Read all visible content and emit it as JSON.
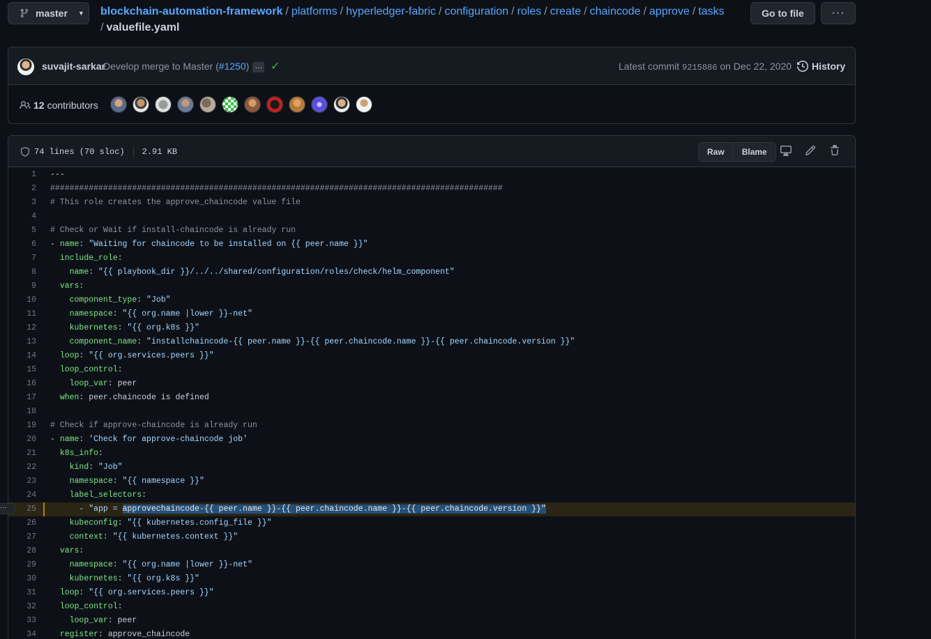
{
  "branch": {
    "label": "master",
    "icon": "git-branch-icon"
  },
  "breadcrumb": {
    "repo": "blockchain-automation-framework",
    "parts": [
      "platforms",
      "hyperledger-fabric",
      "configuration",
      "roles",
      "create",
      "chaincode",
      "approve",
      "tasks"
    ],
    "file": "valuefile.yaml",
    "separator": "/"
  },
  "actions": {
    "goto_file": "Go to file",
    "more": "···"
  },
  "commit": {
    "author": "suvajit-sarkar",
    "message": "Develop merge to Master (",
    "pr": "#1250",
    "message_end": ")",
    "ellipsis": "…",
    "status": "✓",
    "latest_prefix": "Latest commit",
    "sha": "9215886",
    "date": "on Dec 22, 2020",
    "history": "History"
  },
  "contributors": {
    "count": "12",
    "label": "contributors",
    "avatar_colors": [
      "#5a6b8a",
      "#3a3a3a",
      "#9a9a9a",
      "#6d7a95",
      "#7a6a5a",
      "#3fb950",
      "#8a5a3a",
      "#c81e1e",
      "#b07a3a",
      "#5b4fd8",
      "#2a2a2a",
      "#d0b090"
    ]
  },
  "file": {
    "lines": "74 lines (70 sloc)",
    "size": "2.91 KB",
    "raw": "Raw",
    "blame": "Blame"
  },
  "code": [
    {
      "n": "1",
      "t": "---"
    },
    {
      "n": "2",
      "t": "##############################################################################################"
    },
    {
      "n": "3",
      "t": "# This role creates the approve_chaincode value file"
    },
    {
      "n": "4",
      "t": ""
    },
    {
      "n": "5",
      "t": "# Check or Wait if install-chaincode is already run"
    },
    {
      "n": "6",
      "t": "- name: \"Waiting for chaincode to be installed on {{ peer.name }}\""
    },
    {
      "n": "7",
      "t": "  include_role:"
    },
    {
      "n": "8",
      "t": "    name: \"{{ playbook_dir }}/../../shared/configuration/roles/check/helm_component\""
    },
    {
      "n": "9",
      "t": "  vars:"
    },
    {
      "n": "10",
      "t": "    component_type: \"Job\""
    },
    {
      "n": "11",
      "t": "    namespace: \"{{ org.name |lower }}-net\""
    },
    {
      "n": "12",
      "t": "    kubernetes: \"{{ org.k8s }}\""
    },
    {
      "n": "13",
      "t": "    component_name: \"installchaincode-{{ peer.name }}-{{ peer.chaincode.name }}-{{ peer.chaincode.version }}\""
    },
    {
      "n": "14",
      "t": "  loop: \"{{ org.services.peers }}\""
    },
    {
      "n": "15",
      "t": "  loop_control:"
    },
    {
      "n": "16",
      "t": "    loop_var: peer"
    },
    {
      "n": "17",
      "t": "  when: peer.chaincode is defined"
    },
    {
      "n": "18",
      "t": ""
    },
    {
      "n": "19",
      "t": "# Check if approve-chaincode is already run"
    },
    {
      "n": "20",
      "t": "- name: 'Check for approve-chaincode job'"
    },
    {
      "n": "21",
      "t": "  k8s_info:"
    },
    {
      "n": "22",
      "t": "    kind: \"Job\""
    },
    {
      "n": "23",
      "t": "    namespace: \"{{ namespace }}\""
    },
    {
      "n": "24",
      "t": "    label_selectors:"
    },
    {
      "n": "25",
      "t": "      - \"app = approvechaincode-{{ peer.name }}-{{ peer.chaincode.name }}-{{ peer.chaincode.version }}\""
    },
    {
      "n": "26",
      "t": "    kubeconfig: \"{{ kubernetes.config_file }}\""
    },
    {
      "n": "27",
      "t": "    context: \"{{ kubernetes.context }}\""
    },
    {
      "n": "28",
      "t": "  vars:"
    },
    {
      "n": "29",
      "t": "    namespace: \"{{ org.name |lower }}-net\""
    },
    {
      "n": "30",
      "t": "    kubernetes: \"{{ org.k8s }}\""
    },
    {
      "n": "31",
      "t": "  loop: \"{{ org.services.peers }}\""
    },
    {
      "n": "32",
      "t": "  loop_control:"
    },
    {
      "n": "33",
      "t": "    loop_var: peer"
    },
    {
      "n": "34",
      "t": "  register: approve_chaincode"
    }
  ],
  "highlight": {
    "line": "25",
    "prefix": "      - \"app = ",
    "selected": "approvechaincode-{{ peer.name }}-{{ peer.chaincode.name }}-{{ peer.chaincode.version }}\""
  },
  "line_menu": "···"
}
